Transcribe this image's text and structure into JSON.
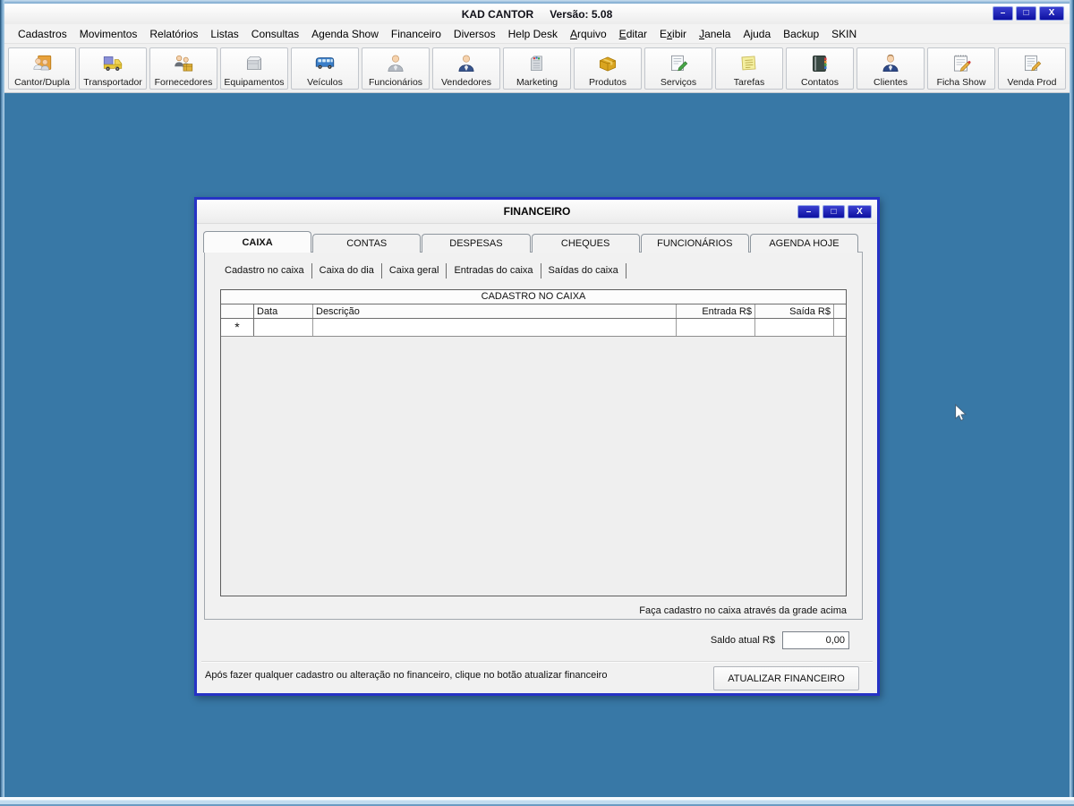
{
  "colors": {
    "desktop": "#3878A6",
    "control_navy": "#0D10A0",
    "dialog_border": "#2633C5",
    "toolbar_bg": "#F0F0F0"
  },
  "window": {
    "title_app": "KAD CANTOR",
    "title_version": "Versão: 5.08",
    "controls": [
      {
        "name": "minimize-button",
        "glyph": "–",
        "cls": "min"
      },
      {
        "name": "maximize-button",
        "glyph": "□",
        "cls": "max"
      },
      {
        "name": "close-button",
        "glyph": "X",
        "cls": "close"
      }
    ]
  },
  "menu": {
    "items": [
      {
        "name": "menu-cadastros",
        "label": "Cadastros"
      },
      {
        "name": "menu-movimentos",
        "label": "Movimentos"
      },
      {
        "name": "menu-relatorios",
        "label": "Relatórios"
      },
      {
        "name": "menu-listas",
        "label": "Listas"
      },
      {
        "name": "menu-consultas",
        "label": "Consultas"
      },
      {
        "name": "menu-agenda-show",
        "label": "Agenda Show"
      },
      {
        "name": "menu-financeiro",
        "label": "Financeiro"
      },
      {
        "name": "menu-diversos",
        "label": "Diversos"
      },
      {
        "name": "menu-help-desk",
        "label": "Help Desk"
      },
      {
        "name": "menu-arquivo",
        "label": "Arquivo",
        "u": 0
      },
      {
        "name": "menu-editar",
        "label": "Editar",
        "u": 0
      },
      {
        "name": "menu-exibir",
        "label": "Exibir",
        "u": 1
      },
      {
        "name": "menu-janela",
        "label": "Janela",
        "u": 0
      },
      {
        "name": "menu-ajuda",
        "label": "Ajuda"
      },
      {
        "name": "menu-backup",
        "label": "Backup"
      },
      {
        "name": "menu-skin",
        "label": "SKIN"
      }
    ]
  },
  "toolbar": {
    "buttons": [
      {
        "name": "toolbar-cantor-dupla",
        "label": "Cantor/Dupla",
        "icon": "cantor-dupla-icon"
      },
      {
        "name": "toolbar-transportador",
        "label": "Transportador",
        "icon": "truck-icon"
      },
      {
        "name": "toolbar-fornecedores",
        "label": "Fornecedores",
        "icon": "suppliers-icon"
      },
      {
        "name": "toolbar-equipamentos",
        "label": "Equipamentos",
        "icon": "equipment-icon"
      },
      {
        "name": "toolbar-veiculos",
        "label": "Veículos",
        "icon": "bus-icon"
      },
      {
        "name": "toolbar-funcionarios",
        "label": "Funcionários",
        "icon": "person-gray-icon"
      },
      {
        "name": "toolbar-vendedores",
        "label": "Vendedores",
        "icon": "person-blue-icon"
      },
      {
        "name": "toolbar-marketing",
        "label": "Marketing",
        "icon": "building-chart-icon"
      },
      {
        "name": "toolbar-produtos",
        "label": "Produtos",
        "icon": "box-icon"
      },
      {
        "name": "toolbar-servicos",
        "label": "Serviços",
        "icon": "document-pencil-green-icon"
      },
      {
        "name": "toolbar-tarefas",
        "label": "Tarefas",
        "icon": "notes-icon"
      },
      {
        "name": "toolbar-contatos",
        "label": "Contatos",
        "icon": "address-book-icon"
      },
      {
        "name": "toolbar-clientes",
        "label": "Clientes",
        "icon": "person-suit-icon"
      },
      {
        "name": "toolbar-ficha-show",
        "label": "Ficha Show",
        "icon": "notepad-pencil-icon"
      },
      {
        "name": "toolbar-venda-prod",
        "label": "Venda Prod",
        "icon": "document-pencil-icon"
      }
    ]
  },
  "dialog": {
    "title": "FINANCEIRO",
    "controls": [
      {
        "name": "dialog-minimize-button",
        "glyph": "–",
        "cls": "min"
      },
      {
        "name": "dialog-maximize-button",
        "glyph": "□",
        "cls": "max"
      },
      {
        "name": "dialog-close-button",
        "glyph": "X",
        "cls": "close"
      }
    ],
    "tabs": [
      {
        "name": "tab-caixa",
        "label": "CAIXA",
        "active": true
      },
      {
        "name": "tab-contas",
        "label": "CONTAS"
      },
      {
        "name": "tab-despesas",
        "label": "DESPESAS"
      },
      {
        "name": "tab-cheques",
        "label": "CHEQUES"
      },
      {
        "name": "tab-funcionarios",
        "label": "FUNCIONÁRIOS"
      },
      {
        "name": "tab-agenda-hoje",
        "label": "AGENDA HOJE"
      }
    ],
    "subtabs": [
      {
        "name": "subtab-cadastro-no-caixa",
        "label": "Cadastro no caixa",
        "active": true
      },
      {
        "name": "subtab-caixa-do-dia",
        "label": "Caixa do dia"
      },
      {
        "name": "subtab-caixa-geral",
        "label": "Caixa geral"
      },
      {
        "name": "subtab-entradas-do-caixa",
        "label": "Entradas do caixa"
      },
      {
        "name": "subtab-saidas-do-caixa",
        "label": "Saídas do caixa"
      }
    ],
    "grid": {
      "caption": "CADASTRO NO CAIXA",
      "columns": [
        {
          "label": "",
          "cls": "c-sel"
        },
        {
          "label": "Data",
          "cls": "c-data"
        },
        {
          "label": "Descrição",
          "cls": "c-desc"
        },
        {
          "label": "Entrada R$",
          "cls": "c-entrada"
        },
        {
          "label": "Saída R$",
          "cls": "c-saida"
        },
        {
          "label": "",
          "cls": "c-fill"
        }
      ],
      "new_row_marker": "*",
      "hint": "Faça cadastro no caixa através da grade acima"
    },
    "saldo": {
      "label": "Saldo atual R$",
      "value": "0,00"
    },
    "footer": {
      "note": "Após fazer qualquer cadastro ou alteração no financeiro, clique no botão atualizar financeiro",
      "button": "ATUALIZAR FINANCEIRO"
    }
  }
}
